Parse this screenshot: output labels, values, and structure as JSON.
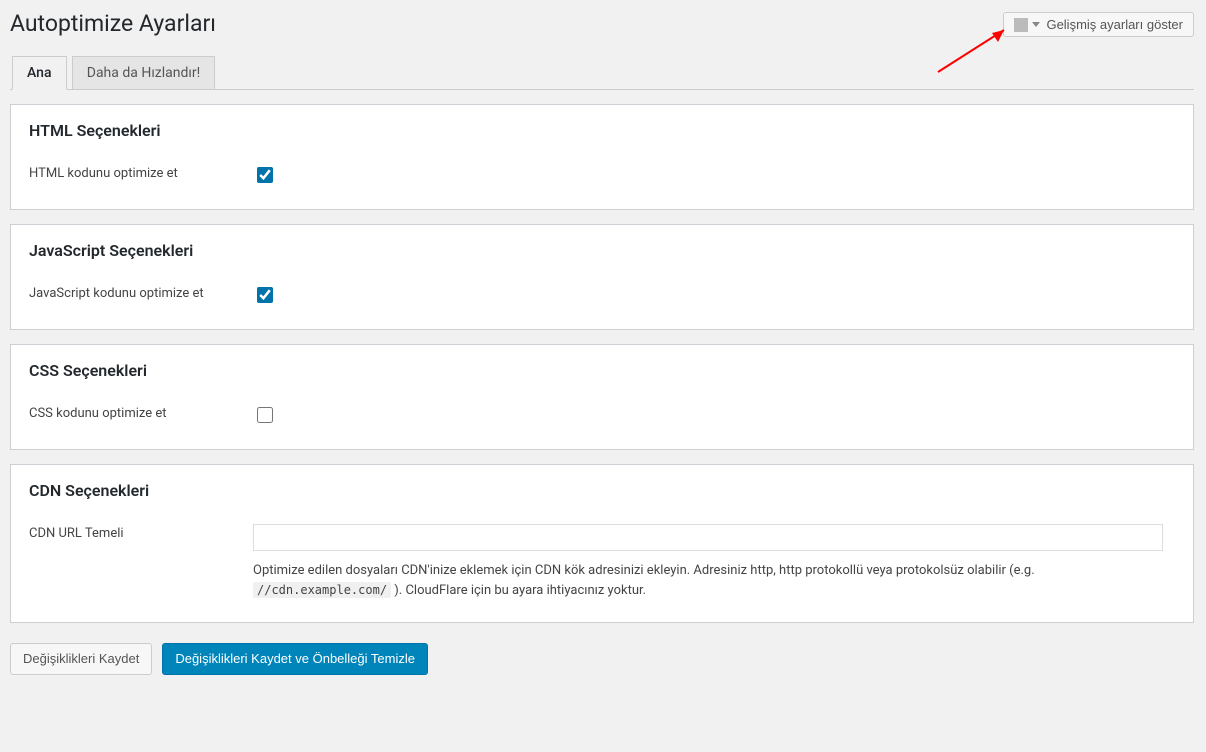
{
  "page": {
    "title": "Autoptimize Ayarları"
  },
  "adv_button": {
    "label": "Gelişmiş ayarları göster"
  },
  "tabs": {
    "main": "Ana",
    "speedup": "Daha da Hızlandır!"
  },
  "panels": {
    "html": {
      "title": "HTML Seçenekleri",
      "row_label": "HTML kodunu optimize et",
      "checked": true
    },
    "js": {
      "title": "JavaScript Seçenekleri",
      "row_label": "JavaScript kodunu optimize et",
      "checked": true
    },
    "css": {
      "title": "CSS Seçenekleri",
      "row_label": "CSS kodunu optimize et",
      "checked": false
    },
    "cdn": {
      "title": "CDN Seçenekleri",
      "row_label": "CDN URL Temeli",
      "input_value": "",
      "desc_before": "Optimize edilen dosyaları CDN'inize eklemek için CDN kök adresinizi ekleyin. Adresiniz http, http protokollü veya protokolsüz olabilir (e.g. ",
      "desc_code": "//cdn.example.com/",
      "desc_after": " ). CloudFlare için bu ayara ihtiyacınız yoktur."
    }
  },
  "buttons": {
    "save": "Değişiklikleri Kaydet",
    "save_clear": "Değişiklikleri Kaydet ve Önbelleği Temizle"
  }
}
